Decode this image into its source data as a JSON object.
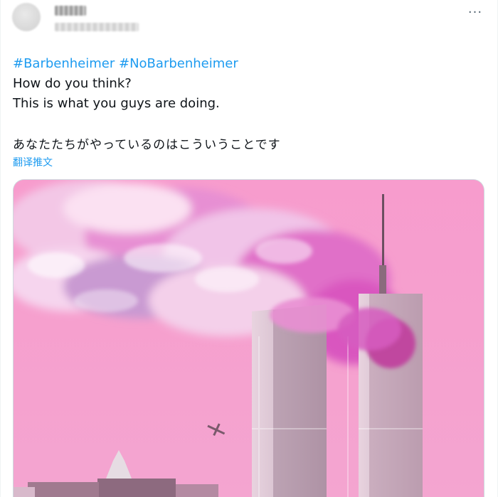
{
  "tweet": {
    "hashtags": [
      "#Barbenheimer",
      "#NoBarbenheimer"
    ],
    "lines": [
      "How do you think?",
      "This is what you guys are doing."
    ],
    "japanese_line": "あなたたちがやっているのはこういうことです",
    "translate_label": "翻译推文",
    "more_icon": "···"
  },
  "colors": {
    "link": "#1d9bf0",
    "text": "#0f1419",
    "muted": "#536471",
    "image_sky": "#f4a1cf"
  },
  "icons": {
    "more": "more-horizontal-icon"
  }
}
